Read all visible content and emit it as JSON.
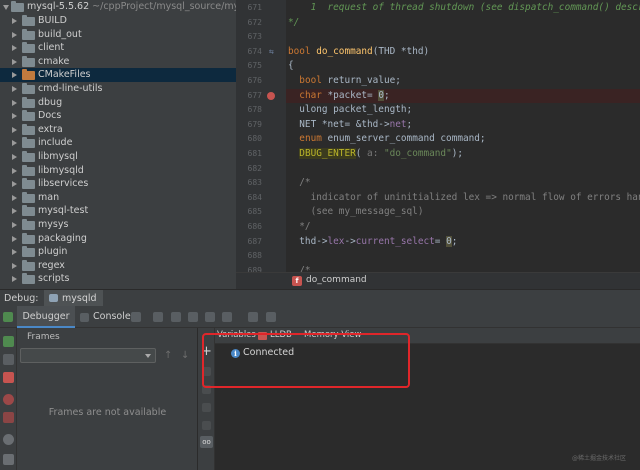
{
  "project": {
    "root": {
      "name": "mysql-5.5.62",
      "path": "~/cppProject/mysql_source/mysql-"
    },
    "folders": [
      {
        "name": "BUILD"
      },
      {
        "name": "build_out"
      },
      {
        "name": "client"
      },
      {
        "name": "cmake"
      },
      {
        "name": "CMakeFiles",
        "selected": true,
        "color": "orange"
      },
      {
        "name": "cmd-line-utils"
      },
      {
        "name": "dbug"
      },
      {
        "name": "Docs"
      },
      {
        "name": "extra"
      },
      {
        "name": "include"
      },
      {
        "name": "libmysql"
      },
      {
        "name": "libmysqld"
      },
      {
        "name": "libservices"
      },
      {
        "name": "man"
      },
      {
        "name": "mysql-test"
      },
      {
        "name": "mysys"
      },
      {
        "name": "packaging"
      },
      {
        "name": "plugin"
      },
      {
        "name": "regex"
      },
      {
        "name": "scripts"
      }
    ]
  },
  "editor": {
    "line_numbers": [
      "671",
      "672",
      "673",
      "674",
      "675",
      "676",
      "677",
      "678",
      "679",
      "680",
      "681",
      "682",
      "683",
      "684",
      "685",
      "686",
      "687",
      "688",
      "689"
    ],
    "lines": [
      {
        "parts": [
          {
            "t": "    1  request of thread shutdown (see dispatch_command() descr",
            "c": "cm"
          }
        ]
      },
      {
        "parts": [
          {
            "t": "*/",
            "c": "cm"
          }
        ]
      },
      {
        "parts": []
      },
      {
        "parts": [
          {
            "t": "bool ",
            "c": "kw"
          },
          {
            "t": "do_command",
            "c": "fn"
          },
          {
            "t": "(THD *thd)",
            "c": ""
          }
        ]
      },
      {
        "parts": [
          {
            "t": "{",
            "c": ""
          }
        ]
      },
      {
        "parts": [
          {
            "t": "  ",
            "c": ""
          },
          {
            "t": "bool ",
            "c": "kw"
          },
          {
            "t": "return_value;",
            "c": ""
          }
        ]
      },
      {
        "parts": [
          {
            "t": "  ",
            "c": ""
          },
          {
            "t": "char ",
            "c": "kw"
          },
          {
            "t": "*packet= ",
            "c": ""
          },
          {
            "t": "0",
            "c": "mk"
          },
          {
            "t": ";",
            "c": ""
          }
        ]
      },
      {
        "parts": [
          {
            "t": "  ulong packet_length;",
            "c": ""
          }
        ]
      },
      {
        "parts": [
          {
            "t": "  NET *net= &thd->",
            "c": ""
          },
          {
            "t": "net",
            "c": "pu"
          },
          {
            "t": ";",
            "c": ""
          }
        ]
      },
      {
        "parts": [
          {
            "t": "  ",
            "c": ""
          },
          {
            "t": "enum ",
            "c": "kw"
          },
          {
            "t": "enum_server_command command;",
            "c": ""
          }
        ]
      },
      {
        "parts": [
          {
            "t": "  ",
            "c": ""
          },
          {
            "t": "DBUG_ENTER",
            "c": "mac"
          },
          {
            "t": "( ",
            "c": ""
          },
          {
            "t": "a: ",
            "c": "lbl"
          },
          {
            "t": "\"do_command\"",
            "c": "st"
          },
          {
            "t": ");",
            "c": ""
          }
        ]
      },
      {
        "parts": []
      },
      {
        "parts": [
          {
            "t": "  /*",
            "c": "gr"
          }
        ]
      },
      {
        "parts": [
          {
            "t": "    indicator of uninitialized lex => normal flow of errors han",
            "c": "gr"
          }
        ]
      },
      {
        "parts": [
          {
            "t": "    (see my_message_sql)",
            "c": "gr"
          }
        ]
      },
      {
        "parts": [
          {
            "t": "  */",
            "c": "gr"
          }
        ]
      },
      {
        "parts": [
          {
            "t": "  thd->",
            "c": ""
          },
          {
            "t": "lex",
            "c": "pu"
          },
          {
            "t": "->",
            "c": ""
          },
          {
            "t": "current_select",
            "c": "pu"
          },
          {
            "t": "= ",
            "c": ""
          },
          {
            "t": "0",
            "c": "mk"
          },
          {
            "t": ";",
            "c": ""
          }
        ]
      },
      {
        "parts": []
      },
      {
        "parts": [
          {
            "t": "  /*",
            "c": "gr"
          }
        ]
      }
    ],
    "breadcrumb": "do_command"
  },
  "debug": {
    "title": "Debug:",
    "session": "mysqld",
    "tabs": {
      "debugger": "Debugger",
      "console": "Console"
    },
    "frames_header": "Frames",
    "frames_empty": "Frames are not available",
    "var_tabs": {
      "variables": "Variables",
      "lldb": "LLDB",
      "memory": "Memory View"
    },
    "status": "Connected"
  },
  "watermark": "@稀土掘金技术社区",
  "colors": {
    "highlight_box": "#e0262a",
    "breakpoint": "#c75450",
    "accent": "#4a88c7"
  }
}
